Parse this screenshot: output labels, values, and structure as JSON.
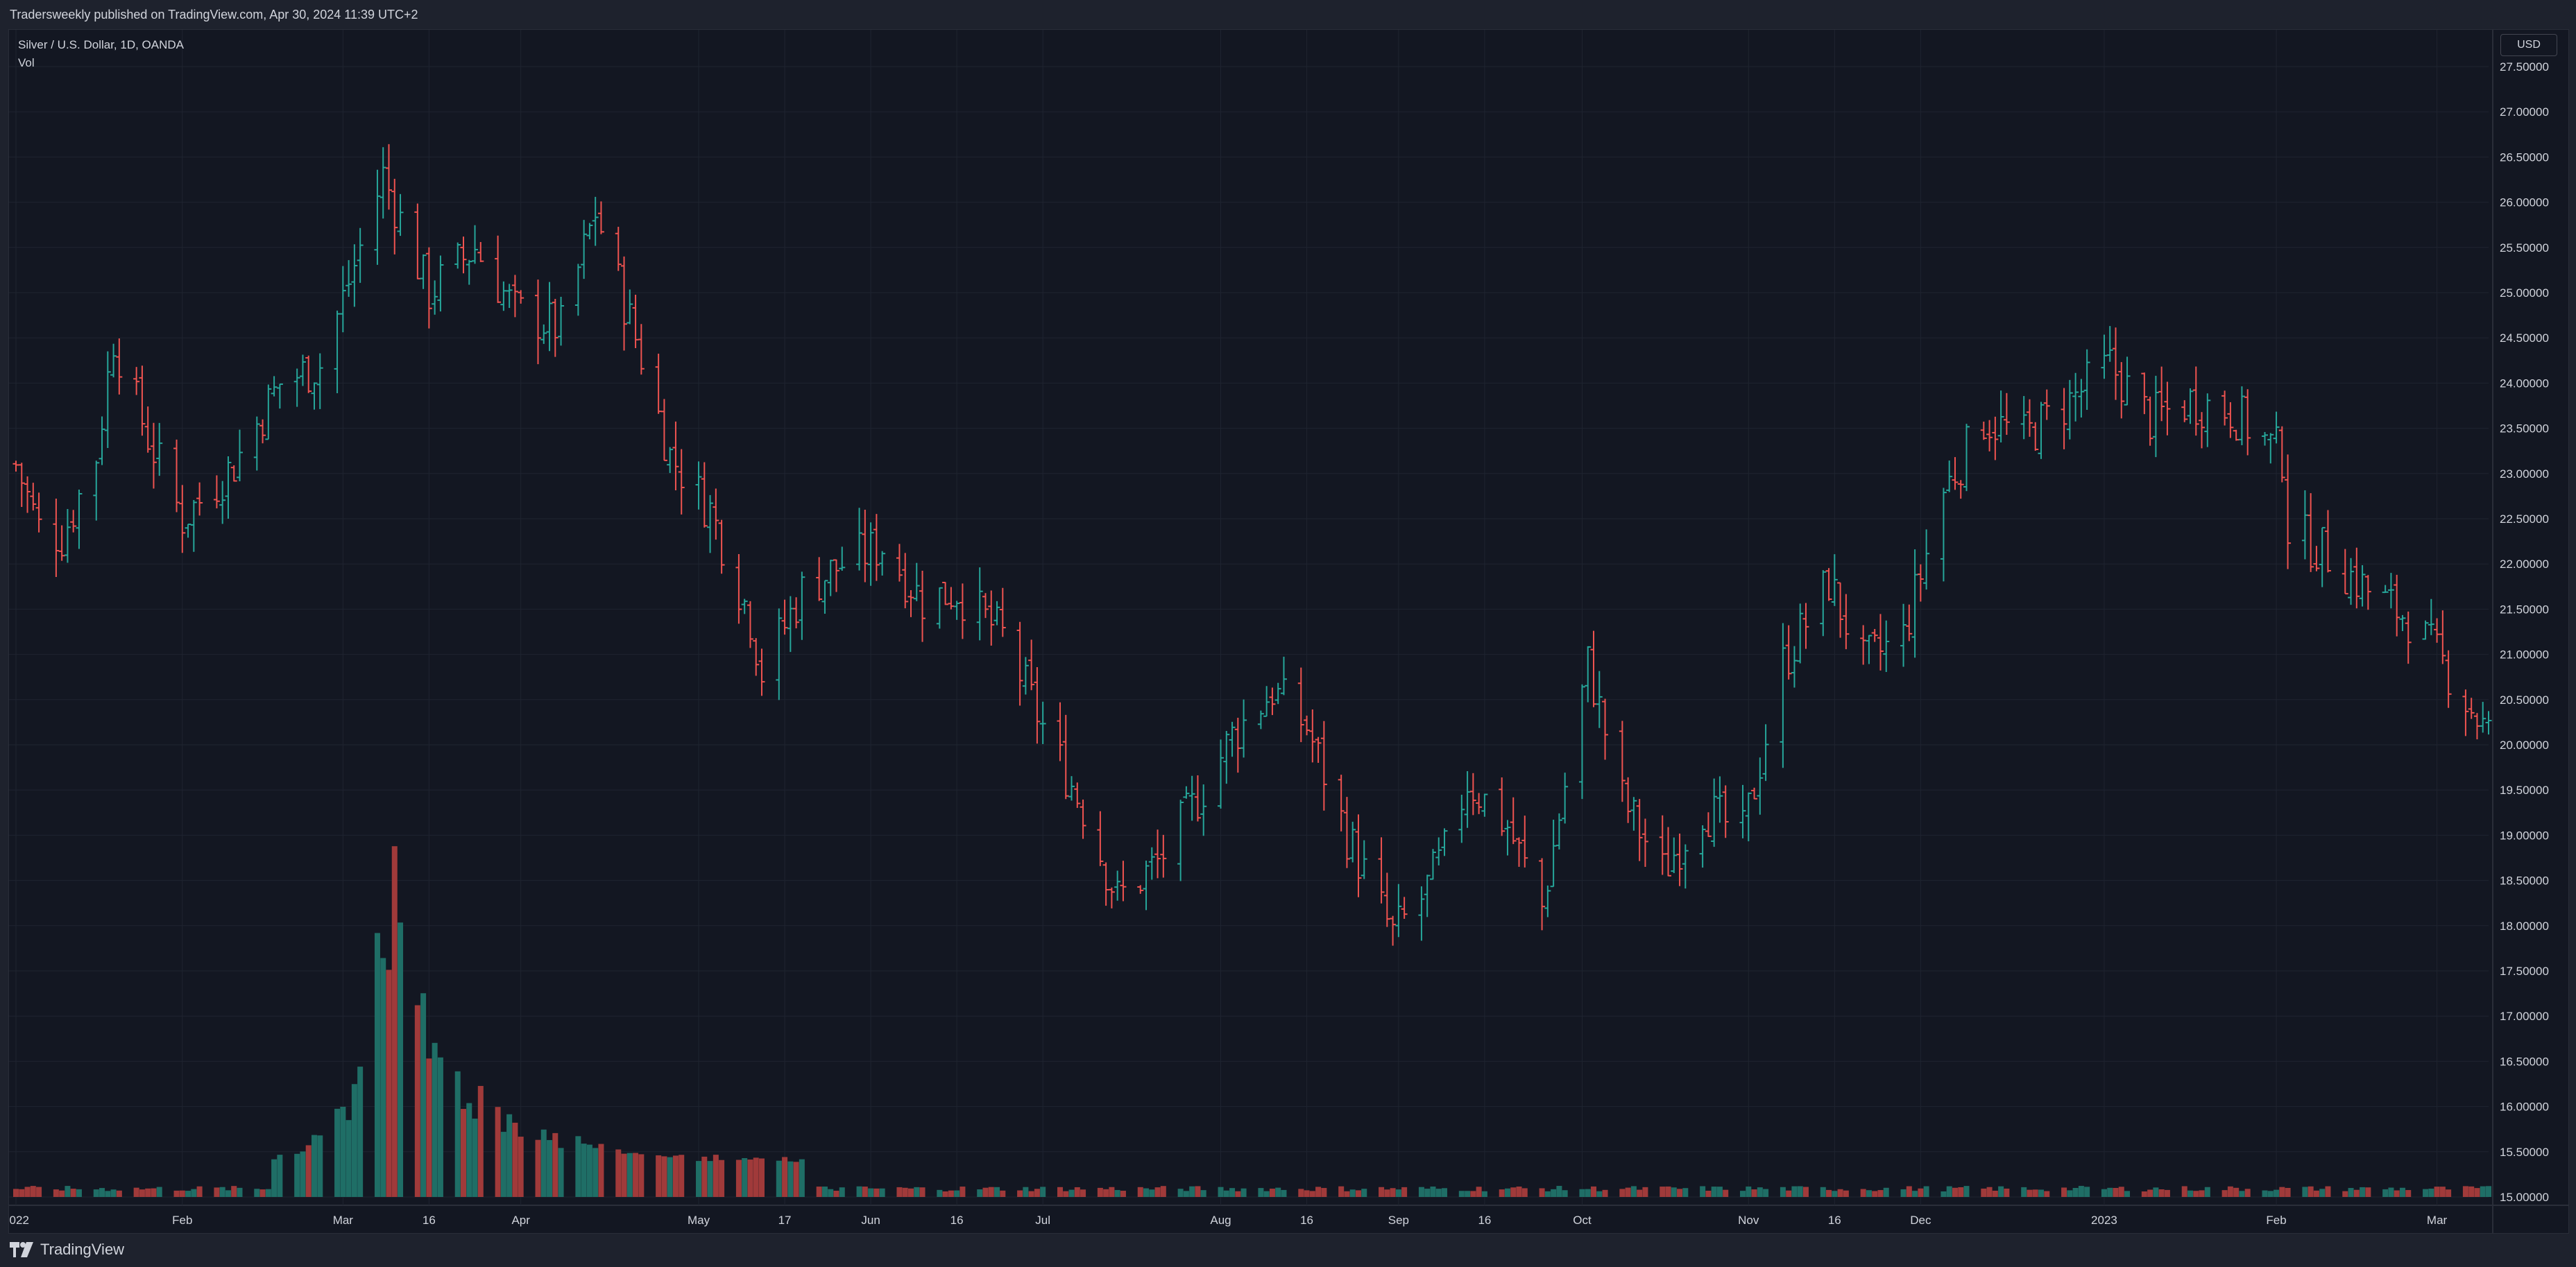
{
  "header": {
    "publish_line": "Tradersweekly published on TradingView.com, Apr 30, 2024 11:39 UTC+2"
  },
  "legend": {
    "symbol_line": "Silver / U.S. Dollar, 1D, OANDA",
    "indicator": "Vol"
  },
  "price_scale": {
    "currency_button": "USD"
  },
  "footer": {
    "brand": "TradingView"
  },
  "colors": {
    "background": "#131722",
    "frame": "#1e222d",
    "grid": "#1f2430",
    "text": "#d1d4dc",
    "up": "#26a69a",
    "down": "#ef5350",
    "vol_up": "#1f6e66",
    "vol_down": "#a03a3a"
  },
  "chart_data": {
    "type": "ohlc",
    "symbol": "Silver / U.S. Dollar",
    "interval": "1D",
    "source": "OANDA",
    "ylim": [
      15.0,
      27.5
    ],
    "y_ticks": [
      "27.50000",
      "27.00000",
      "26.50000",
      "26.00000",
      "25.50000",
      "25.00000",
      "24.50000",
      "24.00000",
      "23.50000",
      "23.00000",
      "22.50000",
      "22.00000",
      "21.50000",
      "21.00000",
      "20.50000",
      "20.00000",
      "19.50000",
      "19.00000",
      "18.50000",
      "18.00000",
      "17.50000",
      "17.00000",
      "16.50000",
      "16.00000",
      "15.50000",
      "15.00000"
    ],
    "x_ticks": [
      {
        "label": "2022",
        "date": "2022-01-03"
      },
      {
        "label": "Feb",
        "date": "2022-02-01"
      },
      {
        "label": "Mar",
        "date": "2022-03-01"
      },
      {
        "label": "16",
        "date": "2022-03-16"
      },
      {
        "label": "Apr",
        "date": "2022-04-01"
      },
      {
        "label": "May",
        "date": "2022-05-02"
      },
      {
        "label": "17",
        "date": "2022-05-17"
      },
      {
        "label": "Jun",
        "date": "2022-06-01"
      },
      {
        "label": "16",
        "date": "2022-06-16"
      },
      {
        "label": "Jul",
        "date": "2022-07-01"
      },
      {
        "label": "Aug",
        "date": "2022-08-01"
      },
      {
        "label": "16",
        "date": "2022-08-16"
      },
      {
        "label": "Sep",
        "date": "2022-09-01"
      },
      {
        "label": "16",
        "date": "2022-09-16"
      },
      {
        "label": "Oct",
        "date": "2022-10-03"
      },
      {
        "label": "Nov",
        "date": "2022-11-01"
      },
      {
        "label": "16",
        "date": "2022-11-16"
      },
      {
        "label": "Dec",
        "date": "2022-12-01"
      },
      {
        "label": "2023",
        "date": "2023-01-02"
      },
      {
        "label": "Feb",
        "date": "2023-02-01"
      },
      {
        "label": "Mar",
        "date": "2023-03-01"
      }
    ],
    "date_range": [
      "2022-01-03",
      "2023-03-10"
    ],
    "price_path": [
      {
        "date": "2022-01-03",
        "close": 23.1
      },
      {
        "date": "2022-01-07",
        "close": 22.4
      },
      {
        "date": "2022-01-11",
        "close": 22.3
      },
      {
        "date": "2022-01-17",
        "close": 23.2
      },
      {
        "date": "2022-01-20",
        "close": 24.5
      },
      {
        "date": "2022-01-26",
        "close": 23.4
      },
      {
        "date": "2022-02-01",
        "close": 22.5
      },
      {
        "date": "2022-02-10",
        "close": 23.1
      },
      {
        "date": "2022-02-18",
        "close": 24.0
      },
      {
        "date": "2022-02-25",
        "close": 24.2
      },
      {
        "date": "2022-03-03",
        "close": 25.3
      },
      {
        "date": "2022-03-08",
        "close": 26.3
      },
      {
        "date": "2022-03-11",
        "close": 25.8
      },
      {
        "date": "2022-03-16",
        "close": 25.0
      },
      {
        "date": "2022-03-24",
        "close": 25.5
      },
      {
        "date": "2022-03-31",
        "close": 24.8
      },
      {
        "date": "2022-04-08",
        "close": 24.6
      },
      {
        "date": "2022-04-14",
        "close": 25.9
      },
      {
        "date": "2022-04-22",
        "close": 24.3
      },
      {
        "date": "2022-04-27",
        "close": 23.2
      },
      {
        "date": "2022-05-04",
        "close": 22.6
      },
      {
        "date": "2022-05-11",
        "close": 21.4
      },
      {
        "date": "2022-05-13",
        "close": 20.8
      },
      {
        "date": "2022-05-20",
        "close": 21.7
      },
      {
        "date": "2022-05-27",
        "close": 22.0
      },
      {
        "date": "2022-06-03",
        "close": 22.2
      },
      {
        "date": "2022-06-10",
        "close": 21.6
      },
      {
        "date": "2022-06-16",
        "close": 21.7
      },
      {
        "date": "2022-06-24",
        "close": 21.2
      },
      {
        "date": "2022-07-01",
        "close": 20.2
      },
      {
        "date": "2022-07-08",
        "close": 19.3
      },
      {
        "date": "2022-07-14",
        "close": 18.3
      },
      {
        "date": "2022-07-21",
        "close": 18.7
      },
      {
        "date": "2022-07-27",
        "close": 19.3
      },
      {
        "date": "2022-08-03",
        "close": 20.1
      },
      {
        "date": "2022-08-10",
        "close": 20.6
      },
      {
        "date": "2022-08-16",
        "close": 20.2
      },
      {
        "date": "2022-08-23",
        "close": 19.0
      },
      {
        "date": "2022-08-31",
        "close": 17.9
      },
      {
        "date": "2022-09-05",
        "close": 18.3
      },
      {
        "date": "2022-09-09",
        "close": 18.8
      },
      {
        "date": "2022-09-13",
        "close": 19.6
      },
      {
        "date": "2022-09-20",
        "close": 19.1
      },
      {
        "date": "2022-09-26",
        "close": 18.2
      },
      {
        "date": "2022-10-04",
        "close": 20.9
      },
      {
        "date": "2022-10-10",
        "close": 19.4
      },
      {
        "date": "2022-10-17",
        "close": 18.6
      },
      {
        "date": "2022-10-24",
        "close": 19.3
      },
      {
        "date": "2022-10-31",
        "close": 19.0
      },
      {
        "date": "2022-11-07",
        "close": 20.9
      },
      {
        "date": "2022-11-15",
        "close": 21.8
      },
      {
        "date": "2022-11-21",
        "close": 20.9
      },
      {
        "date": "2022-11-28",
        "close": 21.2
      },
      {
        "date": "2022-12-05",
        "close": 22.8
      },
      {
        "date": "2022-12-12",
        "close": 23.6
      },
      {
        "date": "2022-12-19",
        "close": 23.4
      },
      {
        "date": "2022-12-27",
        "close": 23.8
      },
      {
        "date": "2023-01-03",
        "close": 24.2
      },
      {
        "date": "2023-01-10",
        "close": 23.6
      },
      {
        "date": "2023-01-17",
        "close": 23.8
      },
      {
        "date": "2023-01-24",
        "close": 23.7
      },
      {
        "date": "2023-02-02",
        "close": 23.2
      },
      {
        "date": "2023-02-03",
        "close": 22.4
      },
      {
        "date": "2023-02-10",
        "close": 22.1
      },
      {
        "date": "2023-02-17",
        "close": 21.7
      },
      {
        "date": "2023-02-24",
        "close": 21.4
      },
      {
        "date": "2023-03-02",
        "close": 20.9
      },
      {
        "date": "2023-03-10",
        "close": 20.1
      }
    ],
    "volume": {
      "shown": true,
      "peak_date": "2022-03-08",
      "notes": "volume low and flat except a spike around early-mid March 2022 and elevated levels in late March–May 2022"
    },
    "grid": true,
    "legend_position": "top-left"
  }
}
